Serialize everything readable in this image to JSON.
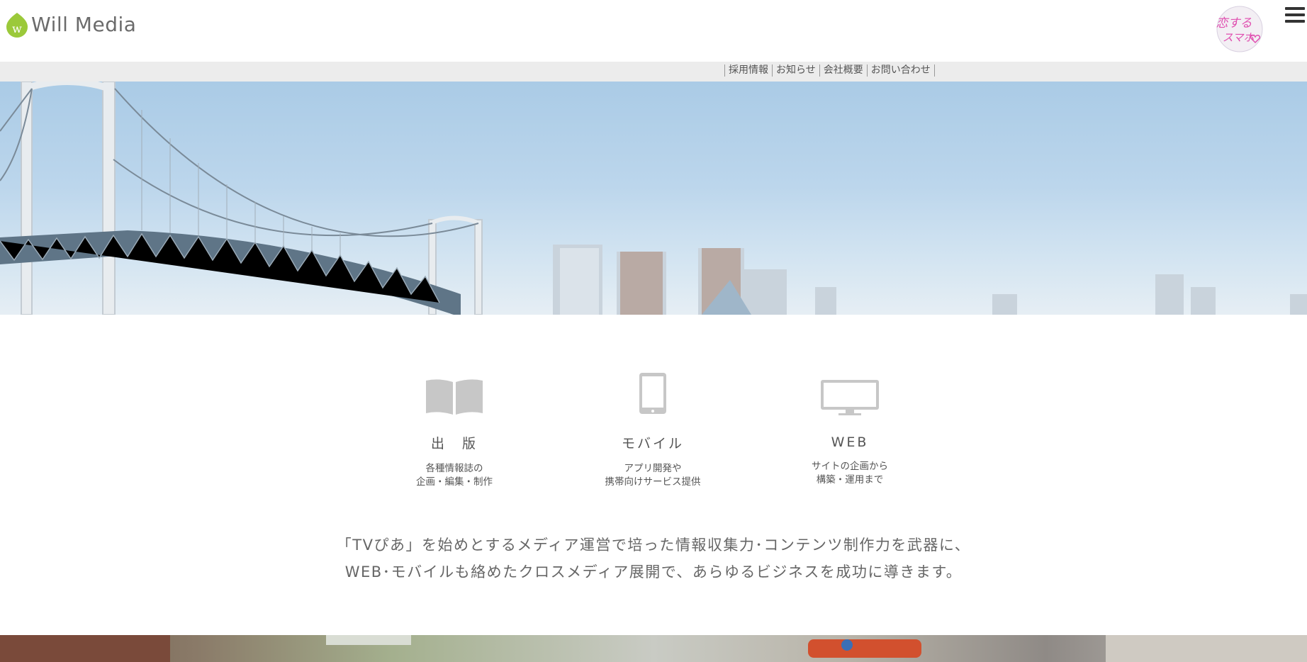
{
  "header": {
    "logo_text": "Will Media",
    "logo_mark_letter": "w",
    "badge_line1": "恋する",
    "badge_line2": "スマホ",
    "colors": {
      "logo_green": "#9bc93a",
      "badge_pink": "#e04fb0"
    }
  },
  "subnav": {
    "items": [
      {
        "label": "採用情報"
      },
      {
        "label": "お知らせ"
      },
      {
        "label": "会社概要"
      },
      {
        "label": "お問い合わせ"
      }
    ]
  },
  "services": [
    {
      "icon": "book-icon",
      "title": "出　版",
      "desc_line1": "各種情報誌の",
      "desc_line2": "企画・編集・制作"
    },
    {
      "icon": "smartphone-icon",
      "title": "モバイル",
      "desc_line1": "アプリ開発や",
      "desc_line2": "携帯向けサービス提供"
    },
    {
      "icon": "monitor-icon",
      "title": "WEB",
      "desc_line1": "サイトの企画から",
      "desc_line2": "構築・運用まで"
    }
  ],
  "tagline": {
    "line1": "「TVぴあ」を始めとするメディア運営で培った情報収集力･コンテンツ制作力を武器に、",
    "line2": "WEB･モバイルも絡めたクロスメディア展開で、あらゆるビジネスを成功に導きます。"
  }
}
